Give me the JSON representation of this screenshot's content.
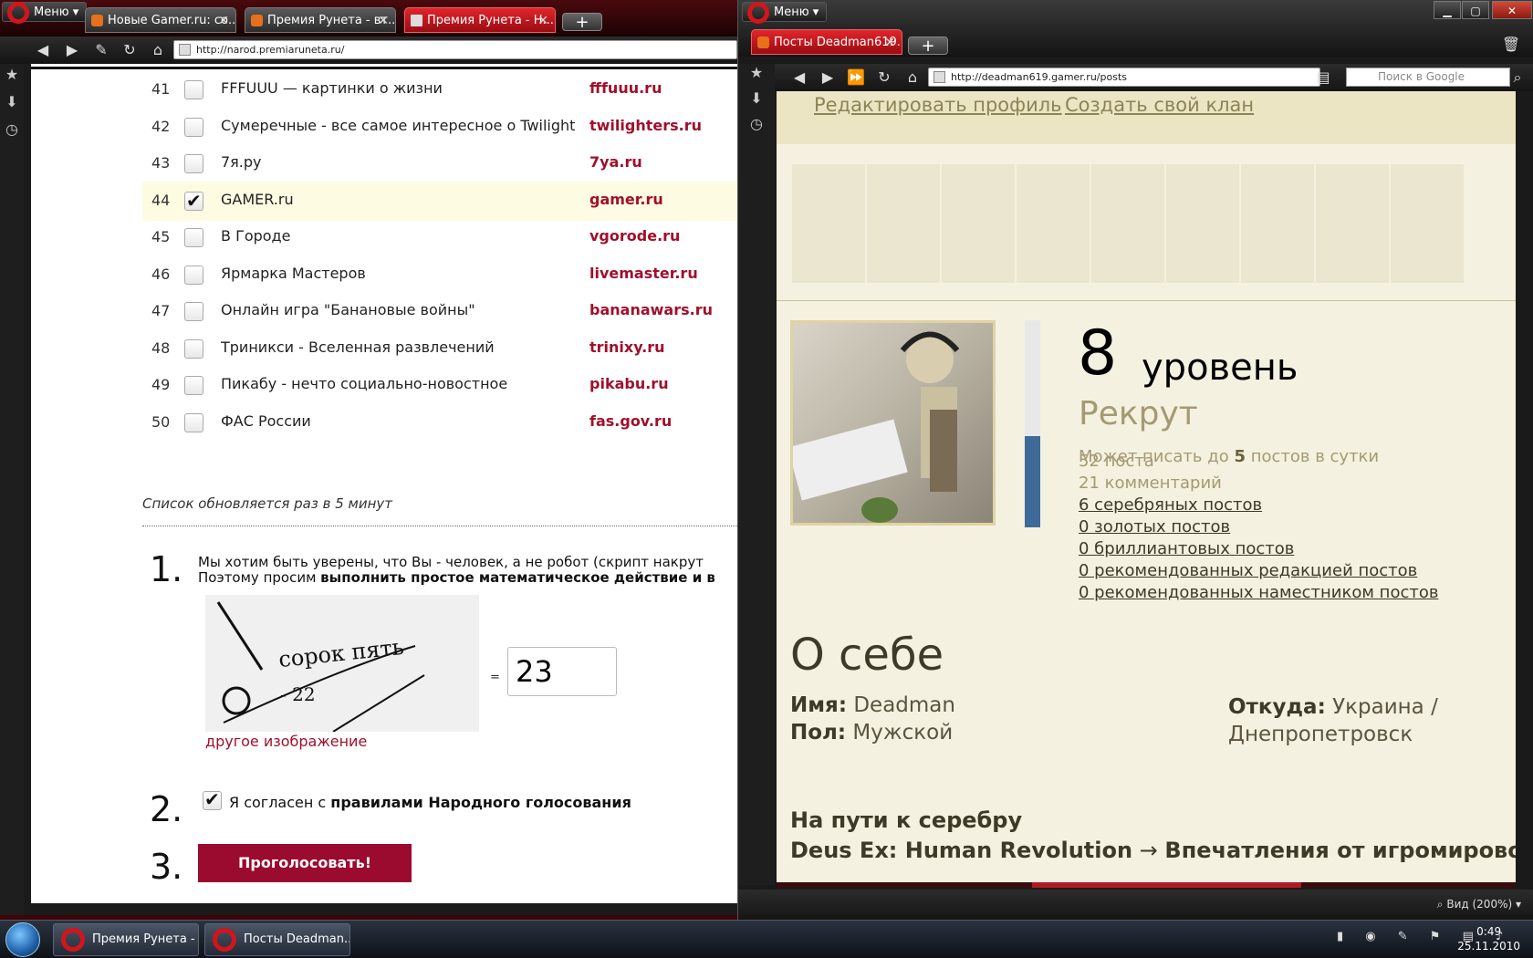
{
  "left_window": {
    "menu_label": "Меню",
    "tabs": [
      {
        "label": "Новые Gamer.ru: со..."
      },
      {
        "label": "Премия Рунета - вт..."
      },
      {
        "label": "Премия Рунета - Н..."
      }
    ],
    "url": "http://narod.premiaruneta.ru/",
    "list": [
      {
        "num": "41",
        "title": "FFFUUU — картинки о жизни",
        "site": "fffuuu.ru",
        "checked": false
      },
      {
        "num": "42",
        "title": "Сумеречные - все самое интересное о Twilight",
        "site": "twilighters.ru",
        "checked": false
      },
      {
        "num": "43",
        "title": "7я.ру",
        "site": "7ya.ru",
        "checked": false
      },
      {
        "num": "44",
        "title": "GAMER.ru",
        "site": "gamer.ru",
        "checked": true
      },
      {
        "num": "45",
        "title": "В Городе",
        "site": "vgorode.ru",
        "checked": false
      },
      {
        "num": "46",
        "title": "Ярмарка Мастеров",
        "site": "livemaster.ru",
        "checked": false
      },
      {
        "num": "47",
        "title": "Онлайн игра \"Банановые войны\"",
        "site": "bananawars.ru",
        "checked": false
      },
      {
        "num": "48",
        "title": "Триникси - Вселенная развлечений",
        "site": "trinixy.ru",
        "checked": false
      },
      {
        "num": "49",
        "title": "Пикабу - нечто социально-новостное",
        "site": "pikabu.ru",
        "checked": false
      },
      {
        "num": "50",
        "title": "ФАС России",
        "site": "fas.gov.ru",
        "checked": false
      }
    ],
    "update_note": "Список обновляется раз в 5 минут",
    "steps": {
      "step1_num": "1.",
      "step1_line1": "Мы хотим быть уверены, что Вы - человек, а не робот (скрипт накрут",
      "step1_line2_plain": "Поэтому просим ",
      "step1_line2_bold": "выполнить простое математическое действие и в",
      "captcha_text": "сорок пять",
      "captcha_num": "- 22",
      "equals": "=",
      "answer_value": "23",
      "other_image_link": "другое изображение",
      "step2_num": "2.",
      "agree_plain": "Я согласен с ",
      "agree_bold": "правилами Народного голосования",
      "step3_num": "3.",
      "vote_button": "Проголосовать!"
    }
  },
  "right_window": {
    "menu_label": "Меню",
    "tab_label": "Посты Deadman619...",
    "url": "http://deadman619.gamer.ru/posts",
    "search_placeholder": "Поиск в Google",
    "top_links": [
      "Редактировать профиль",
      "Создать свой клан"
    ],
    "profile": {
      "level_num": "8",
      "level_word": "уровень",
      "rank": "Рекрут",
      "can_post_prefix": "Может писать до ",
      "can_post_num": "5",
      "can_post_suffix": " постов в сутки",
      "level_progress": 0.44,
      "stats": [
        {
          "text": "52 поста",
          "link": false
        },
        {
          "text": "21 комментарий",
          "link": false
        },
        {
          "text": "6 серебряных постов",
          "link": true
        },
        {
          "text": "0 золотых постов",
          "link": true
        },
        {
          "text": "0 бриллиантовых постов",
          "link": true
        },
        {
          "text": "0 рекомендованных редакцией постов",
          "link": true
        },
        {
          "text": "0 рекомендованных наместником постов",
          "link": true
        }
      ]
    },
    "about": {
      "heading": "О себе",
      "name_label": "Имя:",
      "name_value": "Deadman",
      "gender_label": "Пол:",
      "gender_value": "Мужской",
      "from_label": "Откуда:",
      "from_value_1": "Украина /",
      "from_value_2": "Днепропетровск"
    },
    "silver_heading": "На пути к серебру",
    "post_game": "Deus Ex: Human Revolution",
    "post_arrow": " → ",
    "post_title": "Впечатления от игромирово",
    "zoom_label": "Вид (200%)"
  },
  "taskbar": {
    "tasks": [
      {
        "label": "Премия Рунета - ..."
      },
      {
        "label": "Посты Deadman..."
      }
    ],
    "time": "0:49",
    "date": "25.11.2010"
  }
}
